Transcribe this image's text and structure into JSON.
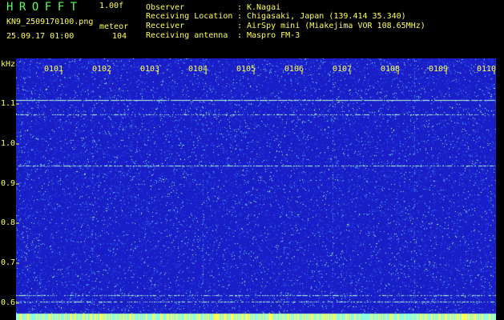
{
  "header": {
    "app_title": "HROFFT",
    "version": "1.00f",
    "filename": "KN9_2509170100.png",
    "mode": "meteor",
    "datetime": "25.09.17 01:00",
    "count": "104"
  },
  "info": [
    {
      "label": "Observer",
      "value": "K.Nagai"
    },
    {
      "label": "Receiving Location",
      "value": "Chigasaki, Japan (139.414 35.340)"
    },
    {
      "label": "Receiver",
      "value": "AirSpy mini (Miakejima VOR 108.65MHz)"
    },
    {
      "label": "Receiving antenna",
      "value": "Maspro FM-3"
    }
  ],
  "separator": ":",
  "spectrogram": {
    "unit_label": "kHz",
    "y_ticks": [
      "1.1",
      "1.0",
      "0.9",
      "0.8",
      "0.7",
      "0.6"
    ],
    "time_labels": [
      "0101",
      "0102",
      "0103",
      "0104",
      "0105",
      "0106",
      "0107",
      "0108",
      "0109",
      "0110"
    ],
    "colors": {
      "background": "#1a1ec8",
      "noise": "#2f7cff",
      "signal": "#8effe6",
      "text": "#ffff55",
      "title": "#55ff55"
    }
  }
}
